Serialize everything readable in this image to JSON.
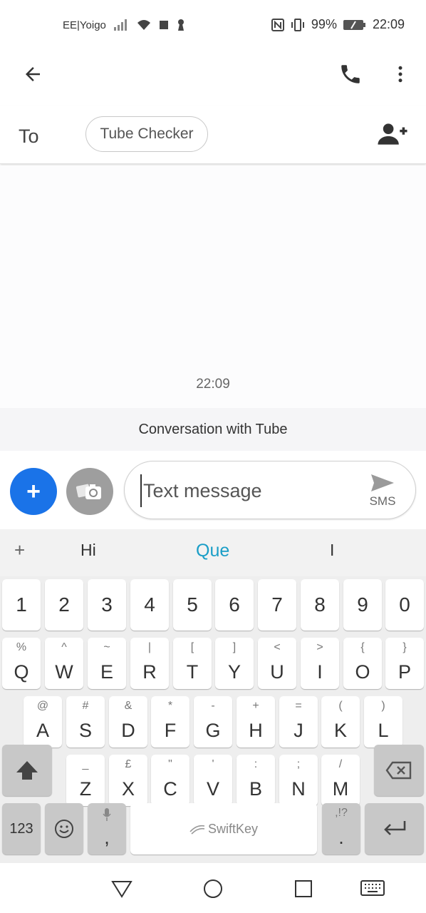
{
  "status_bar": {
    "carrier": "EE|Yoigo",
    "battery": "99%",
    "time": "22:09"
  },
  "app_bar": {
    "back_icon": "arrow-back-icon",
    "call_icon": "phone-icon",
    "more_icon": "more-vert-icon"
  },
  "to_row": {
    "label": "To",
    "recipient": "Tube Checker",
    "add_contact_icon": "person-add-icon"
  },
  "conversation": {
    "timestamp": "22:09",
    "conversation_with": "Conversation with Tube"
  },
  "compose": {
    "placeholder": "Text message",
    "send_label": "SMS",
    "plus_label": "+",
    "accent": "#1a73e8"
  },
  "keyboard": {
    "suggestions": [
      "+",
      "Hi",
      "Que",
      "I"
    ],
    "numbers": [
      "1",
      "2",
      "3",
      "4",
      "5",
      "6",
      "7",
      "8",
      "9",
      "0"
    ],
    "row1": [
      {
        "k": "Q",
        "a": "%"
      },
      {
        "k": "W",
        "a": "^"
      },
      {
        "k": "E",
        "a": "~"
      },
      {
        "k": "R",
        "a": "|"
      },
      {
        "k": "T",
        "a": "["
      },
      {
        "k": "Y",
        "a": "]"
      },
      {
        "k": "U",
        "a": "<"
      },
      {
        "k": "I",
        "a": ">"
      },
      {
        "k": "O",
        "a": "{"
      },
      {
        "k": "P",
        "a": "}"
      }
    ],
    "row2": [
      {
        "k": "A",
        "a": "@"
      },
      {
        "k": "S",
        "a": "#"
      },
      {
        "k": "D",
        "a": "&"
      },
      {
        "k": "F",
        "a": "*"
      },
      {
        "k": "G",
        "a": "-"
      },
      {
        "k": "H",
        "a": "+"
      },
      {
        "k": "J",
        "a": "="
      },
      {
        "k": "K",
        "a": "("
      },
      {
        "k": "L",
        "a": ")"
      }
    ],
    "row3": [
      {
        "k": "Z",
        "a": "_"
      },
      {
        "k": "X",
        "a": "£"
      },
      {
        "k": "C",
        "a": "\""
      },
      {
        "k": "V",
        "a": "'"
      },
      {
        "k": "B",
        "a": ":"
      },
      {
        "k": "N",
        "a": ";"
      },
      {
        "k": "M",
        "a": "/"
      }
    ],
    "numbers_key": "123",
    "space_label": "SwiftKey",
    "comma": ",",
    "period": ".",
    "period_alt": ",!?"
  },
  "nav_bar": {
    "back_icon": "nav-back-triangle-icon",
    "home_icon": "nav-home-circle-icon",
    "recents_icon": "nav-recents-square-icon",
    "keyboard_icon": "keyboard-icon"
  }
}
